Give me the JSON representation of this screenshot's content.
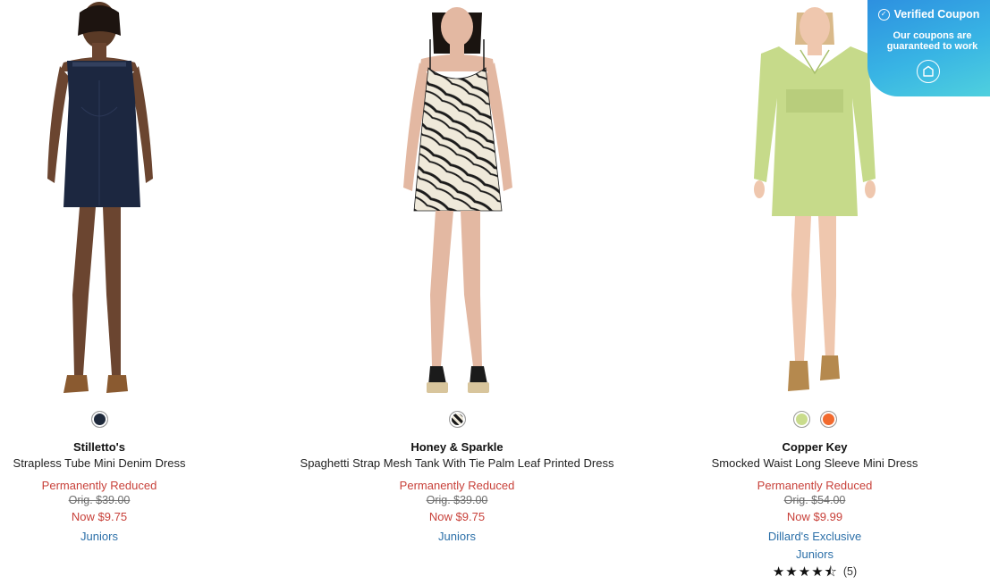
{
  "products": [
    {
      "brand": "Stilletto's",
      "name": "Strapless Tube Mini Denim Dress",
      "badge": "Permanently Reduced",
      "orig_price": "Orig. $39.00",
      "now_price": "Now $9.75",
      "links": [
        "Juniors"
      ],
      "swatches": [
        "#1f2a3c"
      ]
    },
    {
      "brand": "Honey & Sparkle",
      "name": "Spaghetti Strap Mesh Tank With Tie Palm Leaf Printed Dress",
      "badge": "Permanently Reduced",
      "orig_price": "Orig. $39.00",
      "now_price": "Now $9.75",
      "links": [
        "Juniors"
      ],
      "swatches": [
        "pattern-palm"
      ]
    },
    {
      "brand": "Copper Key",
      "name": "Smocked Waist Long Sleeve Mini Dress",
      "badge": "Permanently Reduced",
      "orig_price": "Orig. $54.00",
      "now_price": "Now $9.99",
      "links": [
        "Dillard's Exclusive",
        "Juniors"
      ],
      "swatches": [
        "#c9dc8c",
        "#f26a2e"
      ],
      "rating": {
        "stars": "★★★★⯪",
        "value": 4.5,
        "count": "(5)"
      }
    }
  ],
  "coupon": {
    "title": "Verified Coupon",
    "subtitle": "Our coupons are guaranteed to work",
    "icon": "coupon-tag-icon"
  },
  "colors": {
    "sale_red": "#c8413a",
    "link_blue": "#2b6fa8",
    "coupon_gradient_start": "#2d90e0",
    "coupon_gradient_end": "#4fd0de"
  }
}
